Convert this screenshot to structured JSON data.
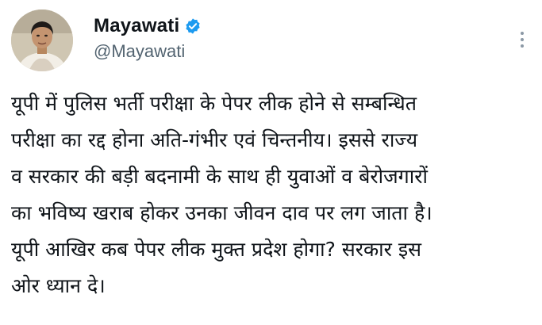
{
  "tweet": {
    "author": {
      "display_name": "Mayawati",
      "handle": "@Mayawati",
      "verified": true,
      "verified_color": "#1d9bf0"
    },
    "more_icon": "more-vertical-icon",
    "text_lines": [
      "यूपी में पुलिस भर्ती परीक्षा के पेपर लीक होने से सम्बन्धित",
      "परीक्षा का रद्द होना अति-गंभीर एवं चिन्तनीय। इससे राज्य",
      "व सरकार की बड़ी बदनामी के साथ ही युवाओं व बेरोजगारों",
      "का भविष्य खराब होकर उनका जीवन दाव पर लग जाता है।",
      "यूपी आखिर कब पेपर लीक मुक्त प्रदेश होगा? सरकार इस",
      "ओर ध्यान दे।"
    ]
  }
}
